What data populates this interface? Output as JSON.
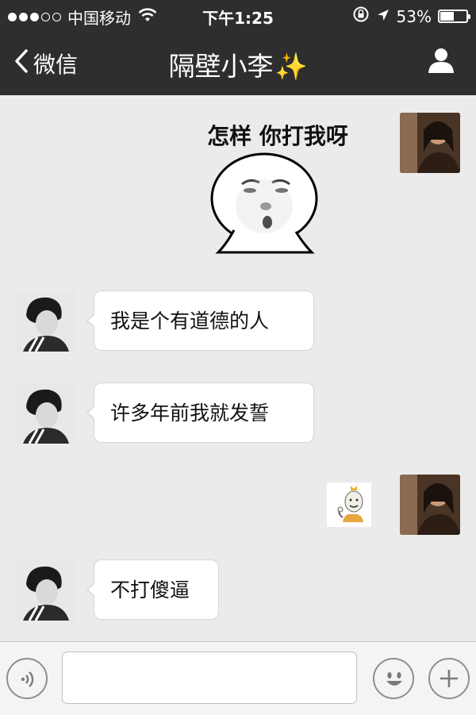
{
  "status": {
    "carrier": "中国移动",
    "time": "下午1:25",
    "battery_text": "53%",
    "battery_level": 0.53,
    "signal_bars_filled": 3,
    "signal_bars_total": 5
  },
  "nav": {
    "back_label": "微信",
    "title": "隔壁小李",
    "title_emoji": "✨"
  },
  "messages": [
    {
      "sender": "self",
      "type": "sticker",
      "caption": "怎样 你打我呀"
    },
    {
      "sender": "other",
      "type": "text",
      "text": "我是个有道德的人"
    },
    {
      "sender": "other",
      "type": "text",
      "text": "许多年前我就发誓"
    },
    {
      "sender": "self",
      "type": "sticker",
      "caption": ""
    },
    {
      "sender": "other",
      "type": "text",
      "text": "不打傻逼"
    }
  ],
  "input": {
    "value": "",
    "placeholder": ""
  },
  "colors": {
    "header_bg": "#2e2e2e",
    "chat_bg": "#ebebeb",
    "bubble_bg": "#ffffff",
    "bottom_bar_bg": "#f4f4f6",
    "title_emoji_color": "#f4d03f"
  },
  "icons": {
    "back": "chevron-left-icon",
    "profile": "person-icon",
    "voice": "voice-icon",
    "emoji": "smiley-icon",
    "more": "plus-icon",
    "wifi": "wifi-icon",
    "lock": "rotation-lock-icon",
    "location": "location-arrow-icon"
  }
}
